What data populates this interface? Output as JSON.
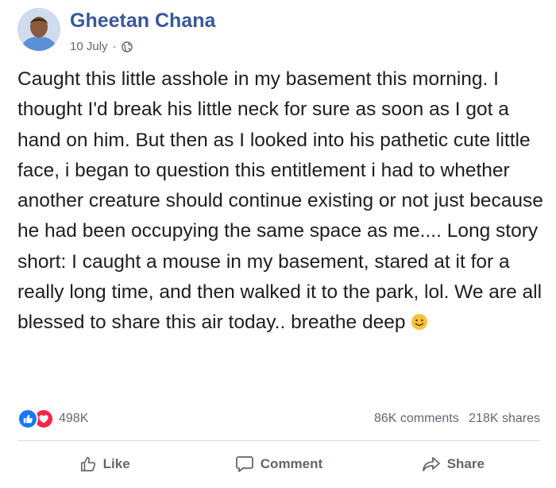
{
  "post": {
    "author": "Gheetan Chana",
    "date": "10 July",
    "separator": "·",
    "privacy_icon": "globe-icon",
    "text": "Caught this little asshole in my basement this morning. I thought I'd break his little neck for sure as soon as I got a hand on him. But then as I looked into his pathetic cute little face, i began to question this entitlement i had to whether another creature should continue existing or not just because he had been occupying the same space as me.... Long story short: I caught a mouse in my basement, stared at it for a really long time, and then walked it to the park, lol. We are all blessed to share this air today.. breathe deep",
    "emoji": "smiley-emoji"
  },
  "stats": {
    "reactions_count": "498K",
    "comments": "86K comments",
    "shares": "218K shares"
  },
  "actions": {
    "like_label": "Like",
    "comment_label": "Comment",
    "share_label": "Share"
  },
  "colors": {
    "author": "#385898",
    "like_blue": "#1877f2",
    "love_red": "#f0284a",
    "muted": "#606770"
  }
}
